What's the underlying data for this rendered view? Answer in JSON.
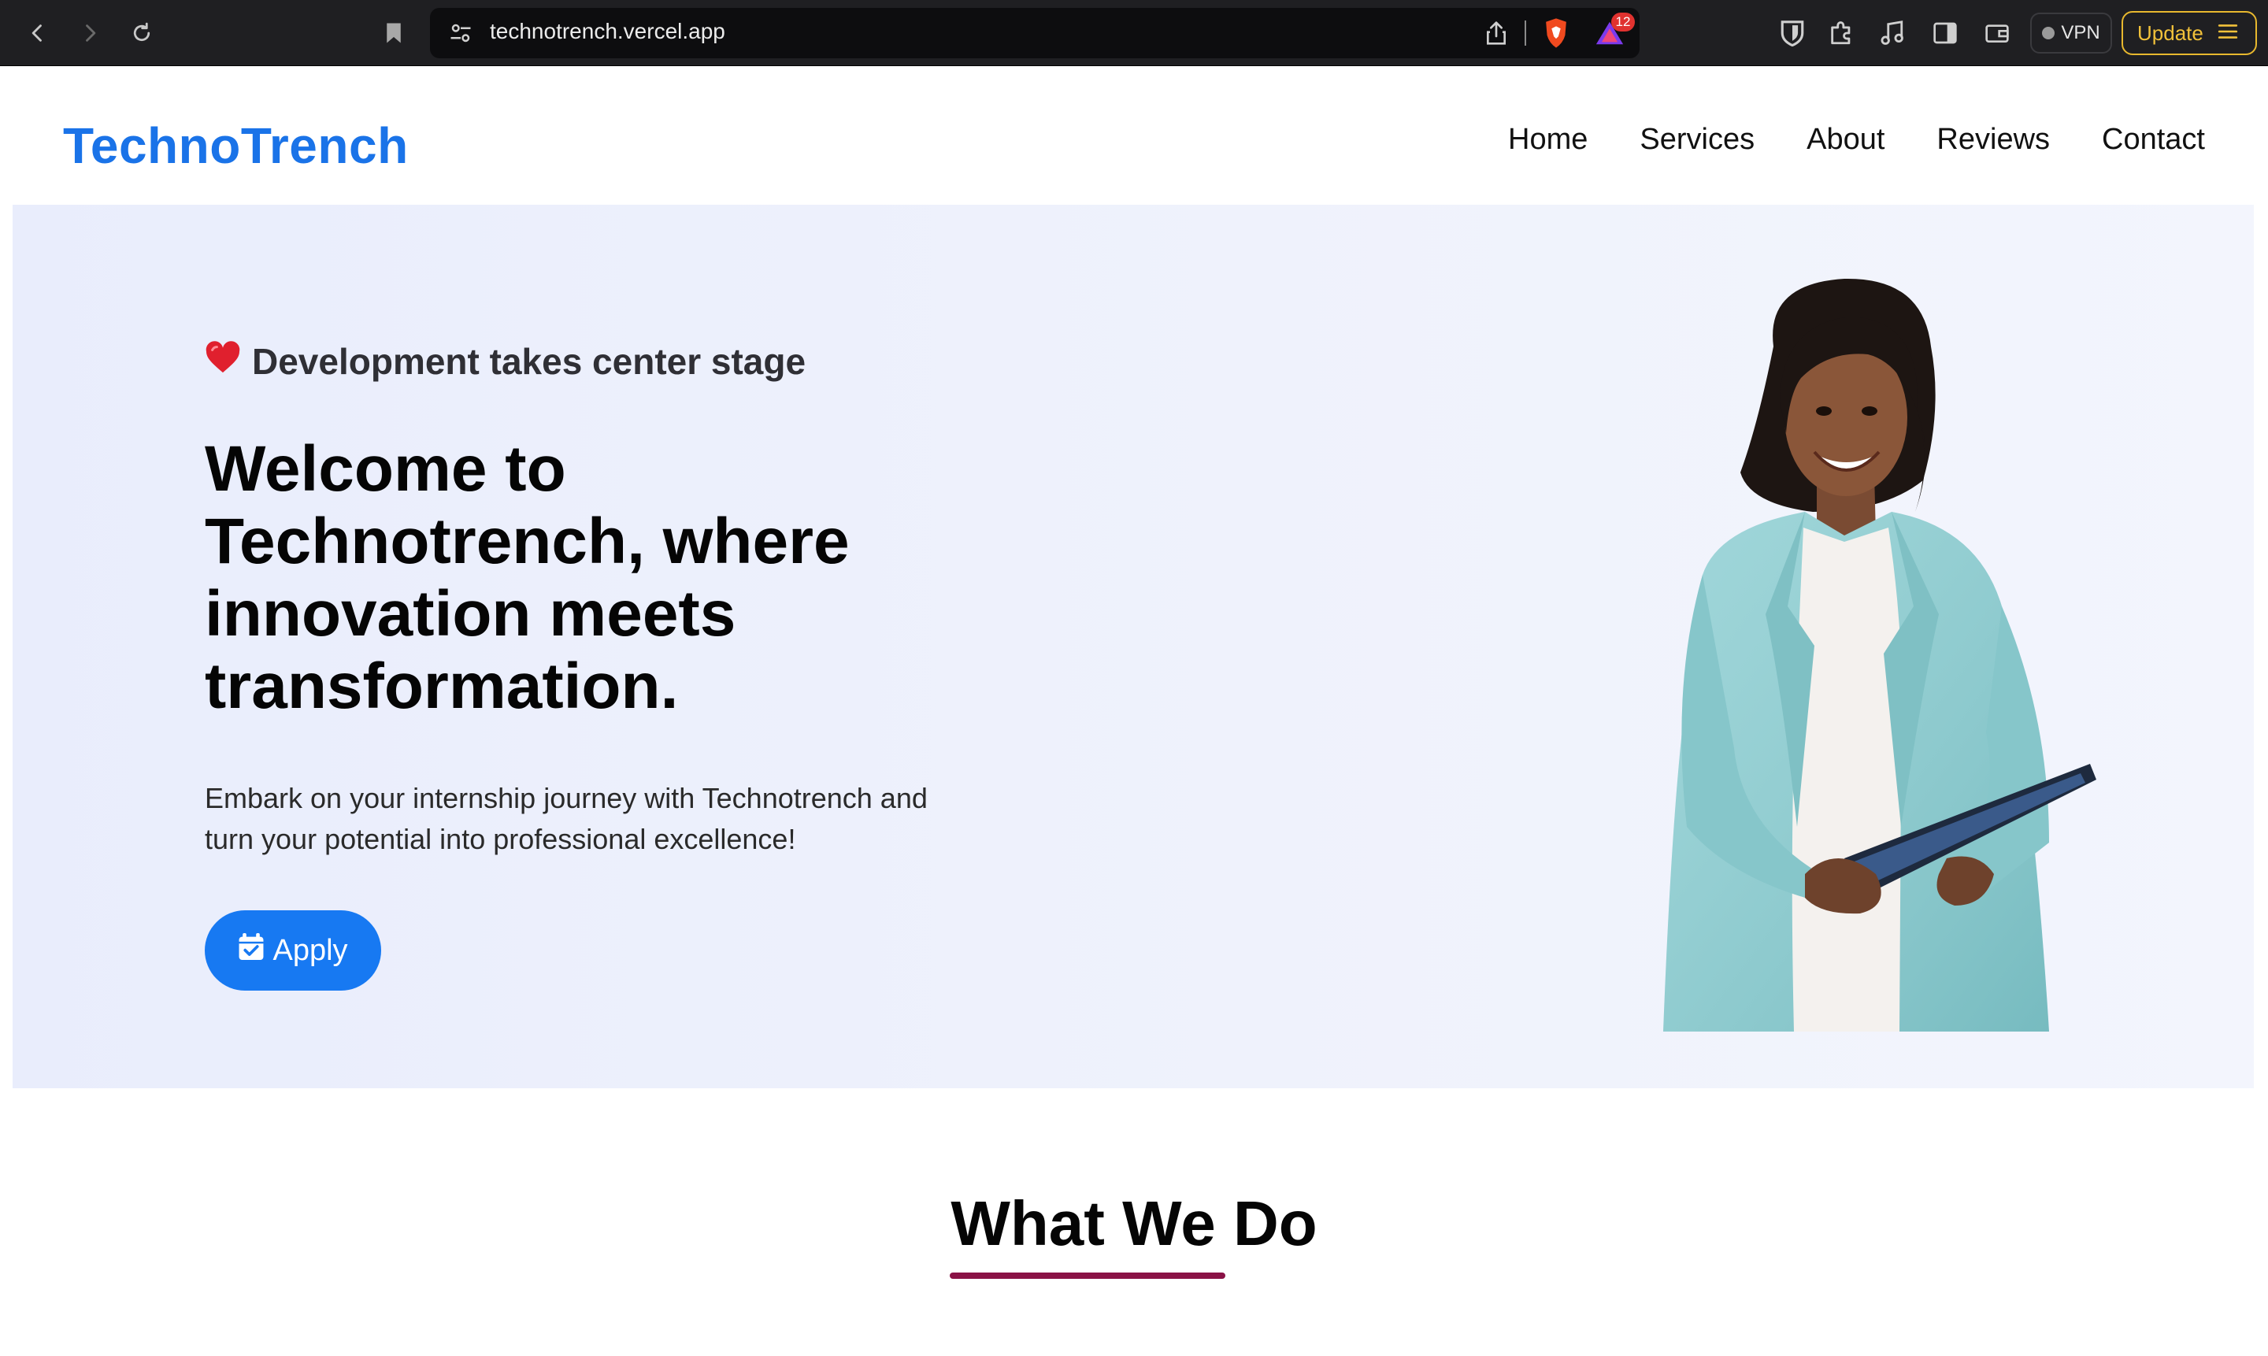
{
  "browser": {
    "url": "technotrench.vercel.app",
    "rewards_badge": "12",
    "vpn_label": "VPN",
    "update_label": "Update",
    "icons": [
      "back-icon",
      "forward-icon",
      "reload-icon",
      "bookmark-icon",
      "site-settings-icon",
      "share-icon",
      "brave-shields-icon",
      "brave-rewards-icon",
      "bitwarden-icon",
      "extensions-icon",
      "media-icon",
      "sidebar-icon",
      "wallet-icon",
      "menu-icon"
    ],
    "colors": {
      "update_accent": "#e8b82e"
    }
  },
  "header": {
    "logo": "TechnoTrench",
    "nav": [
      "Home",
      "Services",
      "About",
      "Reviews",
      "Contact"
    ],
    "colors": {
      "logo": "#1a73e8"
    }
  },
  "hero": {
    "tagline_icon": "heart-icon",
    "tagline": "Development takes center stage",
    "headline": "Welcome to Technotrench, where innovation meets transformation.",
    "subtext": "Embark on your internship journey with Technotrench and turn your potential into professional excellence!",
    "apply_label": "Apply",
    "apply_icon": "calendar-check-icon",
    "colors": {
      "apply_button": "#1779f2",
      "background": "#e9edfc"
    }
  },
  "section": {
    "title": "What We Do",
    "colors": {
      "underline": "#8a1246"
    }
  }
}
